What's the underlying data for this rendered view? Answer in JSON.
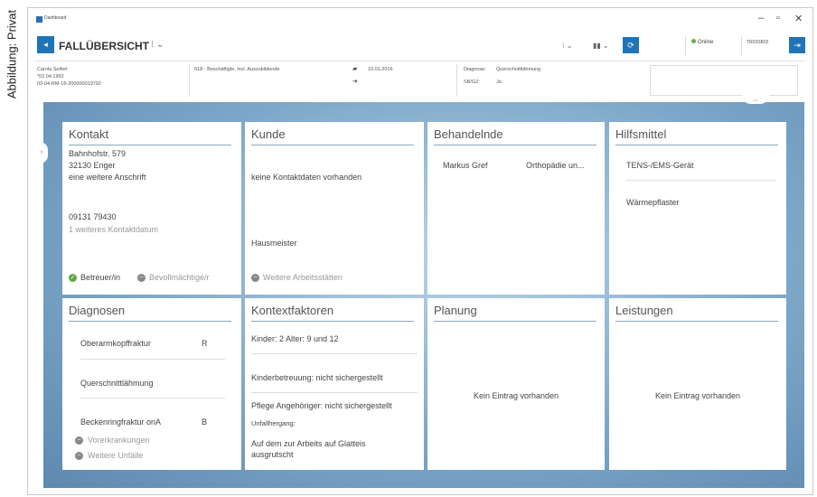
{
  "caption": "Abbildung: Privat",
  "titlebar": {
    "app_name": "Dashboard",
    "minimize": "–",
    "maximize": "▫",
    "close": "✕"
  },
  "toolbar": {
    "page_title": "FALLÜBERSICHT",
    "title_menu": "⁝ ⌄",
    "menu1": "⁝ ⌄",
    "menu2": "▮▮ ⌄"
  },
  "status": {
    "online": "Online",
    "user_id": "TR03SB02"
  },
  "patient": {
    "name": "Carola Seifert",
    "birthdate": "*02.04.1992",
    "case_id": "03-04-RM-16-200000019792",
    "employment": "018 - Beschäftigte, incl. Auszubildende",
    "date": "19.01.2016",
    "diagnosis_label": "Diagnose:",
    "diagnosis_value": "Querschnittlähmung",
    "sbv_label": "SB/GZ:",
    "sbv_value": "Ja"
  },
  "cards": {
    "kontakt": {
      "title": "Kontakt",
      "street": "Bahnhofstr. 579",
      "city": "32130 Enger",
      "extra_address": "eine weitere Anschrift",
      "phone": "09131 79430",
      "more_contact": "1 weiteres Kontaktdatum",
      "betreuer": "Betreuer/in",
      "bevollmaechtigte": "Bevollmächtige/r"
    },
    "kunde": {
      "title": "Kunde",
      "no_contact": "keine Kontaktdaten vorhanden",
      "job": "Hausmeister",
      "more_workplaces": "Weitere Arbeitsstätten"
    },
    "behandelnde": {
      "title": "Behandelnde",
      "name": "Markus Gref",
      "specialty": "Orthopädie un..."
    },
    "hilfsmittel": {
      "title": "Hilfsmittel",
      "items": [
        "TENS-/EMS-Gerät",
        "Wärmepflaster"
      ]
    },
    "diagnosen": {
      "title": "Diagnosen",
      "items": [
        {
          "name": "Oberarmkopffraktur",
          "side": "R"
        },
        {
          "name": "Querschnittlähmung",
          "side": ""
        },
        {
          "name": "Beckenringfraktur onA",
          "side": "B"
        }
      ],
      "previous": "Vorerkrankungen",
      "accidents": "Weitere Unfälle"
    },
    "kontextfaktoren": {
      "title": "Kontextfaktoren",
      "children": "Kinder: 2 Alter: 9 und 12",
      "childcare": "Kinderbetreuung: nicht sichergestellt",
      "care": "Pflege Angehöriger: nicht sichergestellt",
      "accident_label": "Unfallhergang:",
      "accident_text_1": "Auf dem zur Arbeits auf Glatteis",
      "accident_text_2": "ausgrutscht"
    },
    "planung": {
      "title": "Planung",
      "empty": "Kein Eintrag vorhanden"
    },
    "leistungen": {
      "title": "Leistungen",
      "empty": "Kein Eintrag vorhanden"
    }
  },
  "colors": {
    "accent": "#1f74b8",
    "background_gradient": "#7ea8c9",
    "online": "#6ab04c"
  }
}
